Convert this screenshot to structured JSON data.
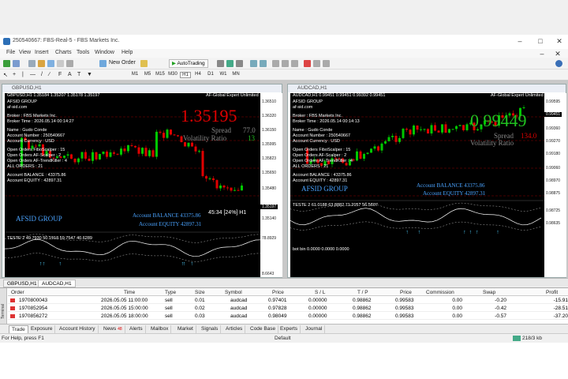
{
  "window": {
    "title": "250540667: FBS-Real-5 - FBS Markets Inc."
  },
  "menu": [
    "File",
    "View",
    "Insert",
    "Charts",
    "Tools",
    "Window",
    "Help"
  ],
  "toolbar": {
    "new_order": "New Order",
    "autotrading": "AutoTrading",
    "timeframes": [
      "M1",
      "M5",
      "M15",
      "M30",
      "H1",
      "H4",
      "D1",
      "W1",
      "MN"
    ]
  },
  "charts": [
    {
      "window_title": "GBPUSD,H1",
      "ohlc": "GBPUSD,H1 1.35184 1.35207 1.35178 1.35197",
      "ea_name": "AF-Global Expert Unlimited",
      "info": [
        "AFSID GROUP",
        "af-sid.com",
        "Broker : FBS Markets Inc.",
        "Broker Time : 2026.05.14 00:14:27",
        "Name : Gudo Conde",
        "Account Number : 250540667",
        "Account Currency : USD",
        "Open Orders FiboScalper : 15",
        "Open Orders AF-Scalper : 2",
        "Open Orders AF-TrendKiller : 4",
        "ALL ORDERS : 21",
        "Account BALANCE : 43375.86",
        "Account EQUITY : 42897.31"
      ],
      "big_price": "1.35195",
      "spread_label": "Spread",
      "spread_value": "77.0",
      "vol_label": "Volatility Ratio",
      "vol_value": "13",
      "footer_balance": "Account BALANCE 43375.86",
      "footer_equity": "Account EQUITY 42897.31",
      "timer": "45:34 [24%] H1",
      "brand": "AFSID GROUP",
      "indicator": "TESTE 2 49.7930 50.1918 59.7547 40.6289",
      "scale": [
        "1.36510",
        "1.36320",
        "1.36150",
        "1.35995",
        "1.35823",
        "1.35650",
        "1.35480",
        "1.35197",
        "1.35140",
        "78.8929",
        "8.6643"
      ]
    },
    {
      "window_title": "AUDCAD,H1",
      "ohlc": "AUDCAD,H1 0.99451 0.99451 0.99392 0.99451",
      "ea_name": "AF-Global Expert Unlimited",
      "info": [
        "AFSID GROUP",
        "af-sid.com",
        "Broker : FBS Markets Inc.",
        "Broker Time : 2026.05.14 00:14:13",
        "Name : Gudo Conde",
        "Account Number : 250540667",
        "Account Currency : USD",
        "Open Orders FiboScalper : 15",
        "Open Orders AF-Scalper : 2",
        "Open Orders AF-TrendKiller : 4",
        "ALL ORDERS : 21",
        "Account BALANCE : 43375.86",
        "Account EQUITY : 42897.31"
      ],
      "big_price": "0.99449",
      "spread_label": "Spread",
      "spread_value": "134.0",
      "vol_label": "Volatility Ratio",
      "vol_value": "",
      "footer_balance": "Account BALANCE 43375.86",
      "footer_equity": "Account EQUITY 42897.31",
      "brand": "AFSID GROUP",
      "indicator": "TESTE 2 61.0188 63.8882 71.2157 56.5607",
      "indicator2": "bot bin 0.0000 0.0000 0.0000",
      "scale": [
        "0.99595",
        "0.99451",
        "0.99360",
        "0.99270",
        "0.99180",
        "0.99060",
        "0.98970",
        "0.98875",
        "0.98725",
        "0.98635"
      ]
    }
  ],
  "chart_tabs": [
    "GBPUSD,H1",
    "AUDCAD,H1"
  ],
  "orders": {
    "headers": [
      "Order",
      "Time",
      "Type",
      "Size",
      "Symbol",
      "Price",
      "S / L",
      "T / P",
      "Price",
      "Commission",
      "Swap",
      "Profit"
    ],
    "rows": [
      [
        "1970800043",
        "2026.05.05 11:00:00",
        "sell",
        "0.01",
        "audcad",
        "0.97401",
        "0.00000",
        "0.98862",
        "0.99583",
        "0.00",
        "-0.20",
        "-15.91"
      ],
      [
        "1970852954",
        "2026.05.05 15:00:00",
        "sell",
        "0.02",
        "audcad",
        "0.97828",
        "0.00000",
        "0.98862",
        "0.99583",
        "0.00",
        "-0.42",
        "-28.51"
      ],
      [
        "1970856272",
        "2026.05.05 18:00:00",
        "sell",
        "0.03",
        "audcad",
        "0.98049",
        "0.00000",
        "0.98862",
        "0.99583",
        "0.00",
        "-0.57",
        "-37.20"
      ]
    ]
  },
  "terminal_label": "Terminal",
  "terminal_tabs": [
    "Trade",
    "Exposure",
    "Account History",
    "News",
    "Alerts",
    "Mailbox",
    "Market",
    "Signals",
    "Articles",
    "Code Base",
    "Experts",
    "Journal"
  ],
  "news_badge": "48",
  "status": {
    "help": "For Help, press F1",
    "profile": "Default",
    "traffic": "218/3 kb"
  },
  "colors": {
    "bull": "#00c800",
    "bear": "#e00000",
    "info_green": "#00ff00",
    "bg": "#000000"
  }
}
